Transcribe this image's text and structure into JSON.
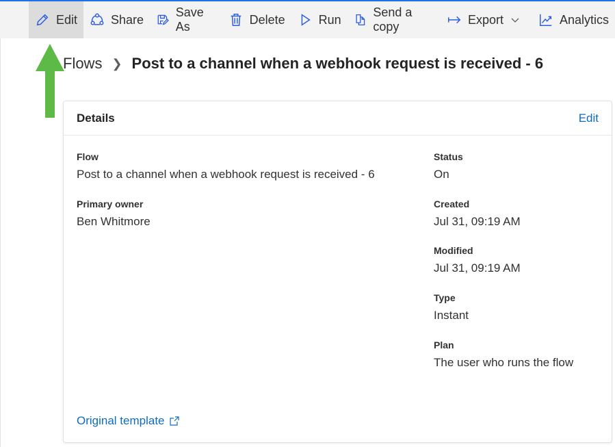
{
  "toolbar": {
    "items": [
      {
        "label": "Edit",
        "icon": "pencil-icon"
      },
      {
        "label": "Share",
        "icon": "share-icon"
      },
      {
        "label": "Save As",
        "icon": "save-as-icon"
      },
      {
        "label": "Delete",
        "icon": "trash-icon"
      },
      {
        "label": "Run",
        "icon": "play-icon"
      },
      {
        "label": "Send a copy",
        "icon": "copy-icon"
      },
      {
        "label": "Export",
        "icon": "export-icon"
      },
      {
        "label": "Analytics",
        "icon": "chart-icon"
      }
    ]
  },
  "breadcrumb": {
    "root": "Flows",
    "current": "Post to a channel when a webhook request is received - 6"
  },
  "details": {
    "heading": "Details",
    "edit": "Edit",
    "flow_label": "Flow",
    "flow_value": "Post to a channel when a webhook request is received - 6",
    "owner_label": "Primary owner",
    "owner_value": "Ben Whitmore",
    "status_label": "Status",
    "status_value": "On",
    "created_label": "Created",
    "created_value": "Jul 31, 09:19 AM",
    "modified_label": "Modified",
    "modified_value": "Jul 31, 09:19 AM",
    "type_label": "Type",
    "type_value": "Instant",
    "plan_label": "Plan",
    "plan_value": "The user who runs the flow",
    "template_link": "Original template"
  },
  "colors": {
    "accent": "#0f6cbd",
    "icon": "#2b5ce6",
    "arrow": "#5dba47"
  }
}
